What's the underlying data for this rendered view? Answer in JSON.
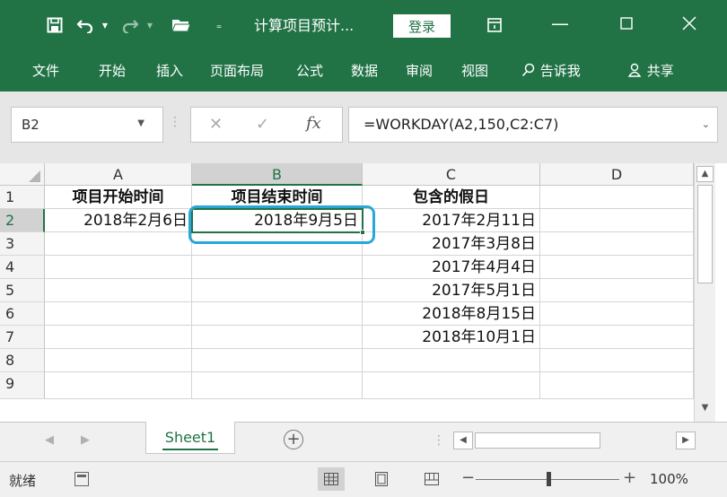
{
  "title_bar": {
    "document_title": "计算项目预计...",
    "login_label": "登录",
    "icons": [
      "save-icon",
      "undo-icon",
      "redo-icon",
      "open-folder-icon",
      "customize-toolbar-icon",
      "ribbon-display-options-icon"
    ],
    "window_controls": [
      "minimize-icon",
      "maximize-icon",
      "close-icon"
    ]
  },
  "ribbon": {
    "tabs": [
      "文件",
      "开始",
      "插入",
      "页面布局",
      "公式",
      "数据",
      "审阅",
      "视图"
    ],
    "tell_me": "告诉我",
    "share": "共享"
  },
  "formula_bar": {
    "name_box": "B2",
    "fx_label": "fx",
    "formula": "=WORKDAY(A2,150,C2:C7)"
  },
  "grid": {
    "columns": [
      "A",
      "B",
      "C",
      "D"
    ],
    "selected_column": "B",
    "rows": [
      "1",
      "2",
      "3",
      "4",
      "5",
      "6",
      "7",
      "8",
      "9"
    ],
    "selected_row": "2",
    "selected_cell": "B2",
    "cells": {
      "A1": "项目开始时间",
      "B1": "项目结束时间",
      "C1": "包含的假日",
      "A2": "2018年2月6日",
      "B2": "2018年9月5日",
      "C2": "2017年2月11日",
      "C3": "2017年3月8日",
      "C4": "2017年4月4日",
      "C5": "2017年5月1日",
      "C6": "2018年8月15日",
      "C7": "2018年10月1日"
    }
  },
  "sheet_tabs": {
    "active": "Sheet1"
  },
  "status_bar": {
    "status": "就绪",
    "zoom": "100%"
  },
  "colors": {
    "excel_green": "#217346",
    "callout_blue": "#2aa7d6"
  }
}
